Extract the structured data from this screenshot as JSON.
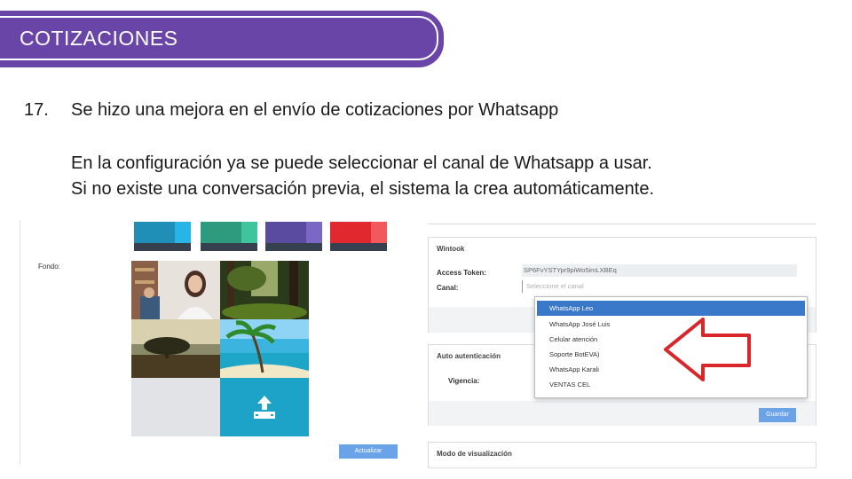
{
  "banner": {
    "title": "COTIZACIONES"
  },
  "item": {
    "number": "17.",
    "heading": "Se hizo una mejora en el envío de cotizaciones por Whatsapp",
    "line1": "En la configuración ya se puede seleccionar el canal de Whatsapp a usar.",
    "line2": "Si no existe una conversación previa, el sistema la crea automáticamente."
  },
  "left_panel": {
    "fondo_label": "Fondo:",
    "update_button": "Actualizar",
    "swatches": [
      "#1f8fb8",
      "#2e9a7e",
      "#5a4aa0",
      "#e0282e"
    ]
  },
  "right_panel": {
    "wintook": {
      "title": "Wintook",
      "access_token_label": "Access Token:",
      "access_token_value": "SP6FvYSTYpr9piWo5imLXBEq",
      "canal_label": "Canal:",
      "canal_placeholder": "Seleccione el canal"
    },
    "dropdown_options": [
      "WhatsApp Leo",
      "WhatsApp José Luis",
      "Celular atención",
      "Soporte BotEVA)",
      "WhatsApp Karali",
      "VENTAS CEL"
    ],
    "auto_auth": {
      "title": "Auto autenticación",
      "vigencia_label": "Vigencia:"
    },
    "save_button": "Guardar",
    "display_mode": {
      "title": "Modo de visualización"
    }
  },
  "colors": {
    "banner": "#6a45a8",
    "selected_option": "#3a78c9",
    "button": "#6aa3e8",
    "arrow": "#d9262b"
  }
}
